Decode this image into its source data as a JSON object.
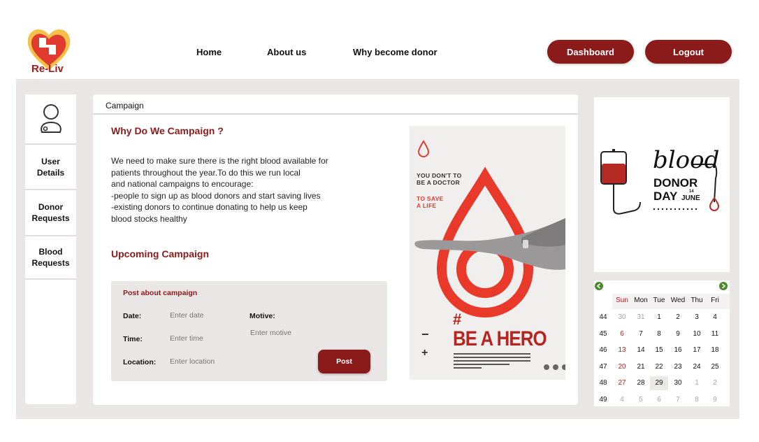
{
  "brand": {
    "name": "Re-Liv",
    "color": "#8b1a1a",
    "logo_icon": "heart-logo-icon"
  },
  "nav": {
    "home": "Home",
    "about": "About us",
    "why": "Why become donor"
  },
  "header_buttons": {
    "dashboard": "Dashboard",
    "logout": "Logout"
  },
  "sidebar": {
    "profile_icon": "user-profile-icon",
    "items": [
      {
        "line1": "User",
        "line2": "Details"
      },
      {
        "line1": "Donor",
        "line2": "Requests"
      },
      {
        "line1": "Blood",
        "line2": "Requests"
      }
    ]
  },
  "main": {
    "tab": "Campaign",
    "why_heading": "Why  Do We Campaign ?",
    "body_lines": [
      "We need to make sure there is the right blood available for",
      "patients throughout the year.To do this we run local",
      "and national campaigns to encourage:",
      "-people to sign up as blood donors and start saving lives",
      "-existing donors to continue donating to help us keep",
      "blood stocks healthy"
    ],
    "upcoming_heading": "Upcoming Campaign"
  },
  "form": {
    "title": "Post about campaign",
    "date_label": "Date:",
    "date_placeholder": "Enter date",
    "time_label": "Time:",
    "time_placeholder": "Enter time",
    "location_label": "Location:",
    "location_placeholder": "Enter location",
    "motive_label": "Motive:",
    "motive_placeholder": "Enter motive",
    "post_button": "Post"
  },
  "poster": {
    "line1": "YOU DON'T TO",
    "line2": "BE A DOCTOR",
    "line3": "TO SAVE",
    "line4": "A LIFE",
    "hash": "#",
    "headline": "BE A HERO",
    "minus": "−",
    "plus": "+"
  },
  "donor_day": {
    "script": "blood",
    "line1": "DONOR",
    "line2": "DAY",
    "day_num": "14",
    "month": "JUNE"
  },
  "calendar": {
    "weekdays": [
      "Sun",
      "Mon",
      "Tue",
      "Wed",
      "Thu",
      "Fri"
    ],
    "weeks": [
      {
        "num": "44",
        "days": [
          "30",
          "31",
          "1",
          "2",
          "3",
          "4"
        ],
        "muted": [
          true,
          true,
          false,
          false,
          false,
          false
        ]
      },
      {
        "num": "45",
        "days": [
          "6",
          "7",
          "8",
          "9",
          "10",
          "11"
        ],
        "muted": [
          false,
          false,
          false,
          false,
          false,
          false
        ]
      },
      {
        "num": "46",
        "days": [
          "13",
          "14",
          "15",
          "16",
          "17",
          "18"
        ],
        "muted": [
          false,
          false,
          false,
          false,
          false,
          false
        ]
      },
      {
        "num": "47",
        "days": [
          "20",
          "21",
          "22",
          "23",
          "24",
          "25"
        ],
        "muted": [
          false,
          false,
          false,
          false,
          false,
          false
        ]
      },
      {
        "num": "48",
        "days": [
          "27",
          "28",
          "29",
          "30",
          "1",
          "2"
        ],
        "muted": [
          false,
          false,
          false,
          false,
          true,
          true
        ]
      },
      {
        "num": "49",
        "days": [
          "4",
          "5",
          "6",
          "7",
          "8",
          "9"
        ],
        "muted": [
          true,
          true,
          true,
          true,
          true,
          true
        ]
      }
    ],
    "today": "29",
    "sunday_color": "#b22222",
    "nav_color": "#4a8a2a"
  }
}
